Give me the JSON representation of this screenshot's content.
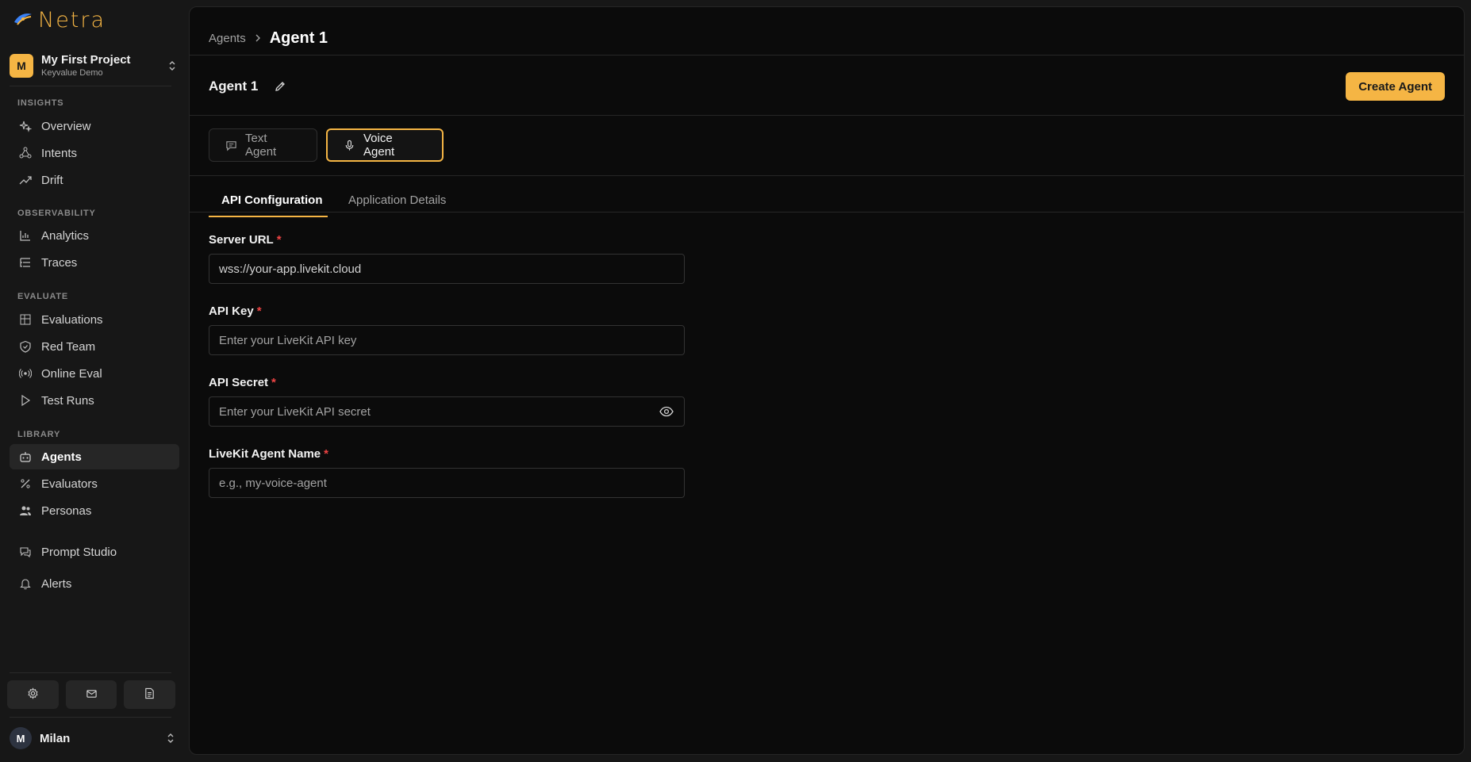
{
  "app": {
    "name": "Netra"
  },
  "project": {
    "badge": "M",
    "name": "My First Project",
    "subtitle": "Keyvalue Demo"
  },
  "sidebar": {
    "sections": [
      {
        "label": "INSIGHTS",
        "items": [
          {
            "label": "Overview",
            "icon": "sparkles-icon"
          },
          {
            "label": "Intents",
            "icon": "network-icon"
          },
          {
            "label": "Drift",
            "icon": "trend-icon"
          }
        ]
      },
      {
        "label": "OBSERVABILITY",
        "items": [
          {
            "label": "Analytics",
            "icon": "bar-chart-icon"
          },
          {
            "label": "Traces",
            "icon": "list-tree-icon"
          }
        ]
      },
      {
        "label": "EVALUATE",
        "items": [
          {
            "label": "Evaluations",
            "icon": "grid-icon"
          },
          {
            "label": "Red Team",
            "icon": "shield-icon"
          },
          {
            "label": "Online Eval",
            "icon": "radio-icon"
          },
          {
            "label": "Test Runs",
            "icon": "play-icon"
          }
        ]
      },
      {
        "label": "LIBRARY",
        "items": [
          {
            "label": "Agents",
            "icon": "bot-icon",
            "active": true
          },
          {
            "label": "Evaluators",
            "icon": "percent-icon"
          },
          {
            "label": "Personas",
            "icon": "users-icon"
          }
        ]
      }
    ],
    "extra": [
      {
        "label": "Prompt Studio",
        "icon": "chat-icon"
      },
      {
        "label": "Alerts",
        "icon": "bell-icon"
      }
    ],
    "footer_buttons": [
      "gear-icon",
      "mail-icon",
      "document-icon"
    ]
  },
  "user": {
    "initial": "M",
    "name": "Milan"
  },
  "breadcrumb": {
    "parent": "Agents",
    "current": "Agent 1"
  },
  "agent": {
    "title": "Agent 1",
    "create_label": "Create Agent"
  },
  "agent_types": [
    {
      "label": "Text Agent",
      "icon": "message-icon",
      "selected": false
    },
    {
      "label": "Voice Agent",
      "icon": "mic-icon",
      "selected": true
    }
  ],
  "tabs": [
    {
      "label": "API Configuration",
      "active": true
    },
    {
      "label": "Application Details",
      "active": false
    }
  ],
  "form": {
    "server_url": {
      "label": "Server URL",
      "value": "wss://your-app.livekit.cloud",
      "required": "*"
    },
    "api_key": {
      "label": "API Key",
      "placeholder": "Enter your LiveKit API key",
      "required": "*"
    },
    "api_secret": {
      "label": "API Secret",
      "placeholder": "Enter your LiveKit API secret",
      "required": "*"
    },
    "agent_name": {
      "label": "LiveKit Agent Name",
      "placeholder": "e.g., my-voice-agent",
      "required": "*"
    }
  },
  "colors": {
    "accent": "#f5b544",
    "required": "#ef4444",
    "panel": "#0b0b0b",
    "sidebar": "#171717"
  }
}
